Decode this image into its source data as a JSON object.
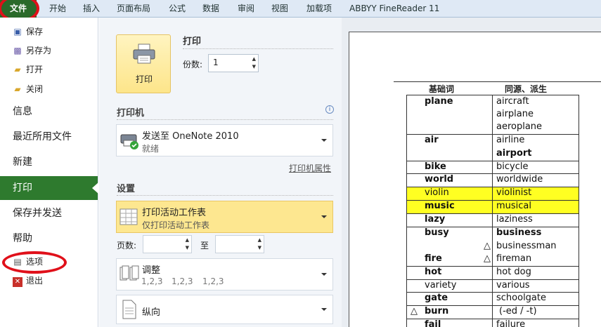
{
  "ribbon": {
    "file_tab": "文件",
    "tabs": [
      "开始",
      "插入",
      "页面布局",
      "公式",
      "数据",
      "审阅",
      "视图",
      "加载项",
      "ABBYY FineReader 11"
    ]
  },
  "nav": {
    "save": "保存",
    "save_as": "另存为",
    "open": "打开",
    "close": "关闭",
    "info": "信息",
    "recent": "最近所用文件",
    "new": "新建",
    "print": "打印",
    "save_send": "保存并发送",
    "help": "帮助",
    "options": "选项",
    "exit": "退出"
  },
  "print_panel": {
    "print_button": "打印",
    "print_heading": "打印",
    "copies_label": "份数:",
    "copies_value": "1",
    "printer_heading": "打印机",
    "printer_name": "发送至 OneNote 2010",
    "printer_status": "就绪",
    "printer_props_link": "打印机属性",
    "settings_heading": "设置",
    "scope_title": "打印活动工作表",
    "scope_sub": "仅打印活动工作表",
    "pages_label": "页数:",
    "to_label": "至",
    "collate_title": "调整",
    "collate_sub": [
      "1,2,3",
      "1,2,3",
      "1,2,3"
    ],
    "orientation": "纵向"
  },
  "preview": {
    "col_headers": [
      "基础词",
      "同源、派生"
    ],
    "rows": [
      {
        "left": "plane",
        "right": [
          "aircraft",
          "airplane",
          "aeroplane"
        ]
      },
      {
        "left": "air",
        "right": [
          "airline",
          "airport"
        ]
      },
      {
        "left": "bike",
        "right": [
          "bicycle"
        ]
      },
      {
        "left": "world",
        "right": [
          "worldwide"
        ]
      },
      {
        "left": "violin",
        "right": [
          "violinist"
        ]
      },
      {
        "left": "music",
        "right": [
          "musical"
        ]
      },
      {
        "left": "lazy",
        "right": [
          "laziness"
        ]
      },
      {
        "left": "busy",
        "right": [
          "business",
          "businessman"
        ]
      },
      {
        "left": "fire",
        "right": [
          "fireman"
        ]
      },
      {
        "left": "hot",
        "right": [
          "hot dog"
        ]
      },
      {
        "left": "variety",
        "right": [
          "various"
        ]
      },
      {
        "left": "gate",
        "right": [
          "schoolgate"
        ]
      },
      {
        "left": "burn",
        "right": [
          "(-ed / -t)"
        ]
      },
      {
        "left": "fail",
        "right": [
          "failure"
        ]
      }
    ],
    "triangle_mark": "△",
    "highlight_color": "#ffff22"
  }
}
